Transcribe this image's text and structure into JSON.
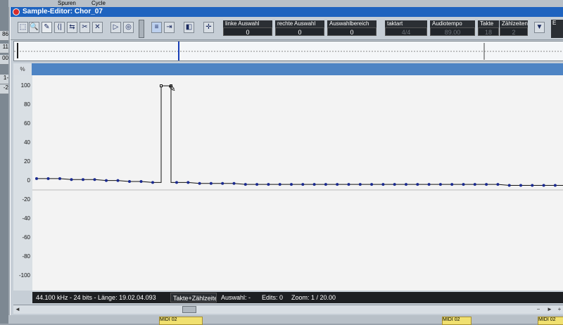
{
  "background": {
    "top_tabs": [
      "Spuren",
      "Cycle"
    ],
    "left_numbers": [
      "86",
      "",
      "11",
      "00",
      "",
      "1-",
      "-2"
    ],
    "bottom_events": [
      "MIDI 02",
      "MIDI 02",
      "MIDI 02"
    ]
  },
  "window": {
    "title": "Sample-Editor: Chor_07"
  },
  "toolbar": {
    "tools": [
      {
        "name": "range-select-tool-icon",
        "glyph": "⬚"
      },
      {
        "name": "zoom-tool-icon",
        "glyph": "🔍"
      },
      {
        "name": "pencil-tool-icon",
        "glyph": "✎"
      },
      {
        "name": "hitpoint-tool-icon",
        "glyph": "⟨|"
      },
      {
        "name": "warp-tool-icon",
        "glyph": "⇆"
      },
      {
        "name": "scissors-tool-icon",
        "glyph": "✂"
      },
      {
        "name": "mute-tool-icon",
        "glyph": "✕"
      }
    ],
    "play_glyph": "▷",
    "loop_glyph": "◎",
    "fields": {
      "left_selection": {
        "label": "linke Auswahl",
        "value": "0"
      },
      "right_selection": {
        "label": "rechte Auswahl",
        "value": "0"
      },
      "selection_range": {
        "label": "Auswahlbereich",
        "value": "0"
      },
      "signature": {
        "label": "taktart",
        "value": "4/4"
      },
      "audio_tempo": {
        "label": "Audiotempo",
        "value": "89.00"
      },
      "bars": {
        "label": "Takte",
        "value": "18"
      },
      "beats": {
        "label": "Zählzeiten",
        "value": "2"
      }
    },
    "extra_label": "E"
  },
  "ruler": {
    "unit_label": "%",
    "ticks": [
      "100",
      "80",
      "60",
      "40",
      "20",
      "0",
      "-20",
      "-40",
      "-60",
      "-80",
      "-100"
    ]
  },
  "chart_data": {
    "type": "line",
    "ylim": [
      -100,
      100
    ],
    "points_before": [
      3,
      3,
      3,
      2,
      2,
      2,
      1,
      1,
      0,
      0,
      -1
    ],
    "spike": {
      "value": 100
    },
    "points_after": [
      -1,
      -1,
      -2,
      -2,
      -2,
      -2,
      -3,
      -3,
      -3,
      -3,
      -3,
      -3,
      -3,
      -3,
      -3,
      -3,
      -3,
      -3,
      -3,
      -3,
      -3,
      -3,
      -3,
      -3,
      -3,
      -3,
      -3,
      -3,
      -3,
      -4,
      -4,
      -4,
      -4,
      -4,
      -4,
      -4
    ]
  },
  "status": {
    "format": "44.100 kHz - 24 bits - Länge: 19.02.04.093",
    "display_mode": "Takte+Zählzeiten",
    "selection": "Auswahl: -",
    "edits": "Edits: 0",
    "zoom": "Zoom: 1 / 20.00"
  },
  "scroll": {
    "left_arrow": "◄",
    "right_arrow": "►",
    "minus": "−",
    "plus": "+"
  }
}
